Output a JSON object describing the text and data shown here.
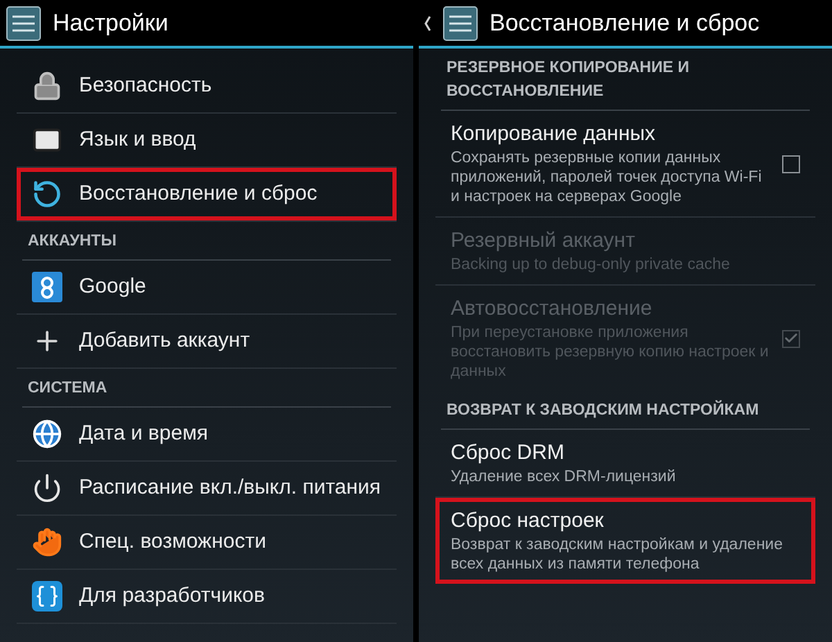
{
  "left_screen": {
    "title": "Настройки",
    "items": [
      {
        "kind": "item",
        "label": "Безопасность",
        "highlighted": false
      },
      {
        "kind": "item",
        "label": "Язык и ввод",
        "highlighted": false
      },
      {
        "kind": "item",
        "label": "Восстановление и сброс",
        "highlighted": true
      },
      {
        "kind": "header",
        "label": "АККАУНТЫ"
      },
      {
        "kind": "item",
        "label": "Google",
        "highlighted": false
      },
      {
        "kind": "item",
        "label": "Добавить аккаунт",
        "highlighted": false
      },
      {
        "kind": "header",
        "label": "СИСТЕМА"
      },
      {
        "kind": "item",
        "label": "Дата и время",
        "highlighted": false
      },
      {
        "kind": "item",
        "label": "Расписание вкл./выкл. питания",
        "highlighted": false
      },
      {
        "kind": "item",
        "label": "Спец. возможности",
        "highlighted": false
      },
      {
        "kind": "item",
        "label": "Для разработчиков",
        "highlighted": false
      }
    ]
  },
  "right_screen": {
    "title": "Восстановление и сброс",
    "items": [
      {
        "kind": "header",
        "label": "РЕЗЕРВНОЕ КОПИРОВАНИЕ И ВОССТАНОВЛЕНИЕ"
      },
      {
        "kind": "checkbox",
        "title": "Копирование данных",
        "summary": "Сохранять резервные копии данных приложений, паролей точек доступа Wi-Fi и настроек на серверах Google",
        "disabled": false,
        "checked": false,
        "highlighted": false
      },
      {
        "kind": "item",
        "title": "Резервный аккаунт",
        "summary": "Backing up to debug-only private cache",
        "disabled": true,
        "highlighted": false
      },
      {
        "kind": "checkbox",
        "title": "Автовосстановление",
        "summary": "При переустановке приложения восстановить резервную копию настроек и данных",
        "disabled": true,
        "checked": true,
        "highlighted": false
      },
      {
        "kind": "header",
        "label": "ВОЗВРАТ К ЗАВОДСКИМ НАСТРОЙКАМ"
      },
      {
        "kind": "item",
        "title": "Сброс DRM",
        "summary": "Удаление всех DRM-лицензий",
        "disabled": false,
        "highlighted": false
      },
      {
        "kind": "item",
        "title": "Сброс настроек",
        "summary": "Возврат к заводским настройкам и удаление всех данных из памяти телефона",
        "disabled": false,
        "highlighted": true
      }
    ]
  }
}
